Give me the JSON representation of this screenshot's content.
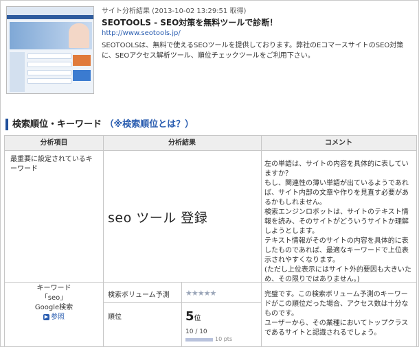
{
  "site": {
    "meta": "サイト分析結果 (2013-10-02 13:29:51 取得)",
    "title": "SEOTOOLS - SEO対策を無料ツールで診断！",
    "url": "http://www.seotools.jp/",
    "description": "SEOTOOLSは、無料で使えるSEOツールを提供しております。弊社のEコマースサイトのSEO対策に、SEOアクセス解析ツール、順位チェックツールをご利用下さい。"
  },
  "section": {
    "heading": "検索順位・キーワード",
    "link": "（※検索順位とは？）"
  },
  "table": {
    "headers": [
      "分析項目",
      "分析結果",
      "コメント"
    ],
    "row1": {
      "label": "最重要に設定されているキーワード",
      "value": "seo  ツール  登録",
      "comment": [
        "左の単語は、サイトの内容を具体的に表していますか？",
        "もし、関連性の薄い単語が出ているようであれば、サイト内部の文章や作りを見直す必要があるかもしれません。",
        "検索エンジンロボットは、サイトのテキスト情報を読み、そのサイトがどういうサイトか理解しようとします。",
        "テキスト情報がそのサイトの内容を具体的に表したものであれば、最適なキーワードで上位表示されやすくなります。",
        "(ただし上位表示にはサイト外的要因も大きいため、その限りではありません。)"
      ]
    },
    "row2": {
      "keyword_label": "キーワード",
      "keyword": "「seo」",
      "engine": "Google検索",
      "ref_link": "参照",
      "volume_label": "検索ボリューム予測",
      "volume_stars": "★★★★★",
      "rank_label": "順位",
      "rank_value": "5",
      "rank_unit": "位",
      "score": "10 / 10",
      "points_label": "10 pts",
      "points_fill": 1.0,
      "comment": [
        "完璧です。この検索ボリューム予測のキーワードがこの順位だった場合、アクセス数は十分なものです。",
        "ユーザーから、その業種においてトップクラスであるサイトと認識されるでしょう。"
      ]
    }
  },
  "colors": {
    "accent": "#1f4f9a",
    "link": "#2a5db0",
    "header_bg": "#eeeeee"
  },
  "icons": {
    "ref": "arrow-circle-icon"
  }
}
